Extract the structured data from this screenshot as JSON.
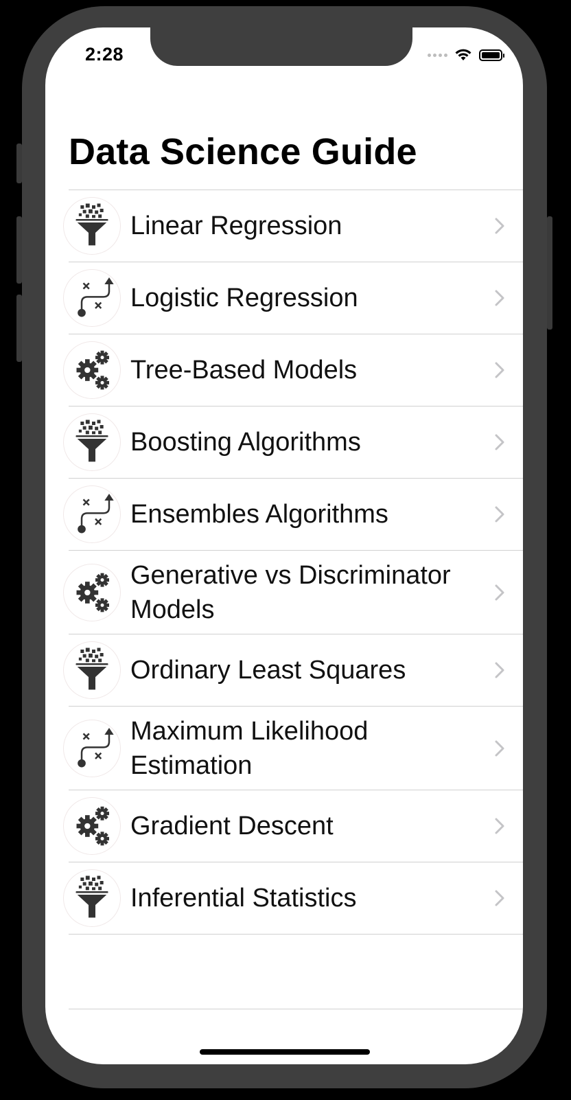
{
  "status_bar": {
    "time": "2:28"
  },
  "header": {
    "title": "Data Science Guide"
  },
  "items": [
    {
      "label": "Linear Regression",
      "icon": "funnel-icon"
    },
    {
      "label": "Logistic Regression",
      "icon": "route-path-icon"
    },
    {
      "label": "Tree-Based Models",
      "icon": "gears-icon"
    },
    {
      "label": "Boosting Algorithms",
      "icon": "funnel-icon"
    },
    {
      "label": "Ensembles Algorithms",
      "icon": "route-path-icon"
    },
    {
      "label": "Generative vs Discriminator Models",
      "icon": "gears-icon"
    },
    {
      "label": "Ordinary Least Squares",
      "icon": "funnel-icon"
    },
    {
      "label": "Maximum Likelihood Estimation",
      "icon": "route-path-icon"
    },
    {
      "label": "Gradient Descent",
      "icon": "gears-icon"
    },
    {
      "label": "Inferential Statistics",
      "icon": "funnel-icon"
    }
  ],
  "colors": {
    "device": "#3f3f3f",
    "separator": "#d0d0d0",
    "chevron": "#c4c4c7",
    "text": "#111111"
  }
}
